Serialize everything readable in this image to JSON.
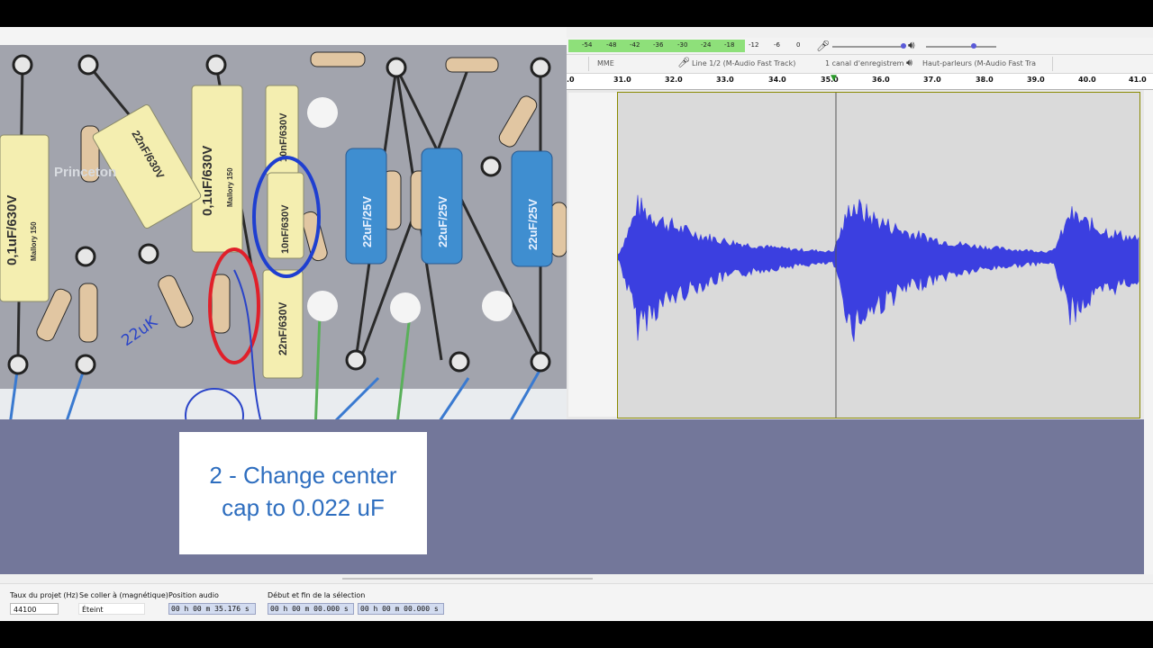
{
  "caption": {
    "line1": "2 - Change center",
    "line2": "cap to 0.022 uF"
  },
  "photo": {
    "labels": {
      "cap_left": "0,1uF/630V",
      "cap_left_brand": "Mallory 150",
      "cap_center": "0,1uF/630V",
      "cap_center_brand": "Mallory 150",
      "cap_tilted": "22nF/630V",
      "cap_top_small": "10nF/630V",
      "cap_blue_circled": "10nF/630V",
      "cap_bottom": "22nF/630V",
      "elec_1": "22uF/25V",
      "elec_2": "22uF/25V",
      "elec_3": "22uF/25V",
      "watermark": "Princeton",
      "handwritten": "22uK"
    }
  },
  "meter": {
    "ticks": [
      "-54",
      "-48",
      "-42",
      "-36",
      "-30",
      "-24",
      "-18",
      "-12",
      "-6",
      "0"
    ]
  },
  "device": {
    "host": "MME",
    "input": "Line 1/2 (M-Audio Fast Track)",
    "channels": "1 canal d'enregistrem",
    "output": "Haut-parleurs (M-Audio Fast Tra"
  },
  "ruler": {
    "labels": [
      ".0",
      "31.0",
      "32.0",
      "33.0",
      "34.0",
      "35.0",
      "36.0",
      "37.0",
      "38.0",
      "39.0",
      "40.0",
      "41.0"
    ]
  },
  "bottom": {
    "rate_label": "Taux du projet (Hz)",
    "rate_value": "44100",
    "snap_label": "Se coller à (magnétique)",
    "snap_value": "Éteint",
    "pos_label": "Position audio",
    "pos_value": "00 h 00 m 35.176 s",
    "sel_label": "Début et fin de la sélection",
    "sel_start": "00 h 00 m 00.000 s",
    "sel_end": "00 h 00 m 00.000 s"
  },
  "colors": {
    "slate": "#73779a",
    "caption_text": "#2e6ebf",
    "waveform": "#3b3fe0",
    "meter_green": "#8ee07a"
  }
}
